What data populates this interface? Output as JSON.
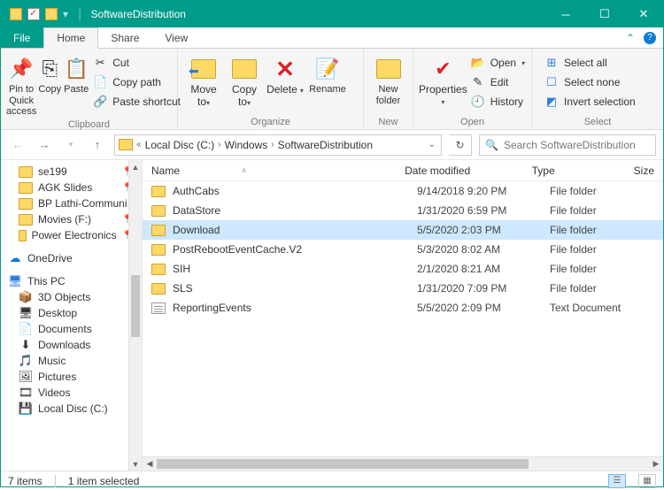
{
  "window": {
    "title": "SoftwareDistribution"
  },
  "tabs": {
    "file": "File",
    "home": "Home",
    "share": "Share",
    "view": "View"
  },
  "ribbon": {
    "clipboard": {
      "pin": "Pin to Quick\naccess",
      "copy": "Copy",
      "paste": "Paste",
      "cut": "Cut",
      "copypath": "Copy path",
      "shortcut": "Paste shortcut",
      "label": "Clipboard"
    },
    "organize": {
      "moveto": "Move\nto",
      "copyto": "Copy\nto",
      "delete": "Delete",
      "rename": "Rename",
      "label": "Organize"
    },
    "new": {
      "newfolder": "New\nfolder",
      "label": "New"
    },
    "open": {
      "properties": "Properties",
      "open": "Open",
      "edit": "Edit",
      "history": "History",
      "label": "Open"
    },
    "select": {
      "all": "Select all",
      "none": "Select none",
      "invert": "Invert selection",
      "label": "Select"
    }
  },
  "breadcrumb": {
    "segs": [
      "Local Disc (C:)",
      "Windows",
      "SoftwareDistribution"
    ]
  },
  "search": {
    "placeholder": "Search SoftwareDistribution"
  },
  "navpane": {
    "quick": [
      {
        "label": "se199",
        "pin": true
      },
      {
        "label": "AGK Slides",
        "pin": true
      },
      {
        "label": "BP Lathi-Communi",
        "pin": false
      },
      {
        "label": "Movies (F:)",
        "pin": true
      },
      {
        "label": "Power Electronics",
        "pin": true
      }
    ],
    "onedrive": "OneDrive",
    "thispc": "This PC",
    "pcitems": [
      {
        "label": "3D Objects",
        "icon": "cube"
      },
      {
        "label": "Desktop",
        "icon": "desktop"
      },
      {
        "label": "Documents",
        "icon": "doc"
      },
      {
        "label": "Downloads",
        "icon": "down"
      },
      {
        "label": "Music",
        "icon": "music"
      },
      {
        "label": "Pictures",
        "icon": "pic"
      },
      {
        "label": "Videos",
        "icon": "vid"
      },
      {
        "label": "Local Disc (C:)",
        "icon": "drive"
      }
    ]
  },
  "columns": {
    "name": "Name",
    "date": "Date modified",
    "type": "Type",
    "size": "Size"
  },
  "files": [
    {
      "name": "AuthCabs",
      "date": "9/14/2018 9:20 PM",
      "type": "File folder",
      "icon": "folder",
      "sel": false
    },
    {
      "name": "DataStore",
      "date": "1/31/2020 6:59 PM",
      "type": "File folder",
      "icon": "folder",
      "sel": false
    },
    {
      "name": "Download",
      "date": "5/5/2020 2:03 PM",
      "type": "File folder",
      "icon": "folder",
      "sel": true
    },
    {
      "name": "PostRebootEventCache.V2",
      "date": "5/3/2020 8:02 AM",
      "type": "File folder",
      "icon": "folder",
      "sel": false
    },
    {
      "name": "SIH",
      "date": "2/1/2020 8:21 AM",
      "type": "File folder",
      "icon": "folder",
      "sel": false
    },
    {
      "name": "SLS",
      "date": "1/31/2020 7:09 PM",
      "type": "File folder",
      "icon": "folder",
      "sel": false
    },
    {
      "name": "ReportingEvents",
      "date": "5/5/2020 2:09 PM",
      "type": "Text Document",
      "icon": "txt",
      "sel": false
    }
  ],
  "status": {
    "count": "7 items",
    "selection": "1 item selected"
  }
}
